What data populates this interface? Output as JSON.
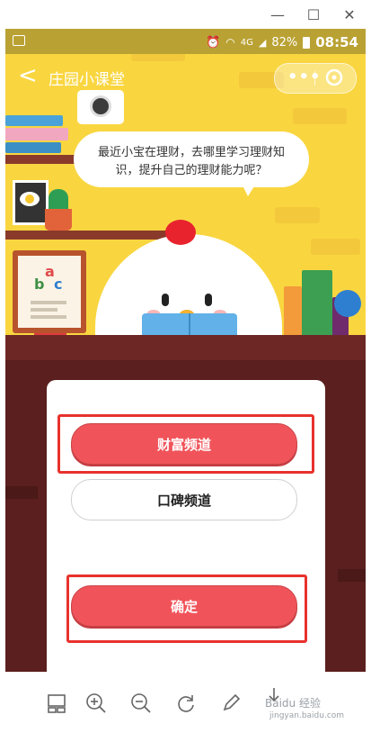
{
  "window": {
    "minimize_glyph": "—",
    "maximize_glyph": "☐",
    "close_glyph": "✕"
  },
  "statusbar": {
    "network": "4G",
    "battery": "82%",
    "time": "08:54"
  },
  "header": {
    "title": "庄园小课堂",
    "back_glyph": "<",
    "more_glyph": "•••"
  },
  "scene": {
    "question_line1": "最近小宝在理财，去哪里学习理财知",
    "question_line2": "识，提升自己的理财能力呢？",
    "abc_a": "a",
    "abc_b": "b",
    "abc_c": "c"
  },
  "quiz": {
    "options": [
      {
        "label": "财富频道",
        "selected": true
      },
      {
        "label": "口碑频道",
        "selected": false
      }
    ],
    "confirm_label": "确定"
  },
  "toolbar": {
    "watermark": "Baidu 经验",
    "watermark_sub": "jingyan.baidu.com"
  },
  "colors": {
    "accent": "#f0545a",
    "highlight": "#e8322d",
    "background": "#f9d640",
    "wood": "#5a1f1e"
  }
}
